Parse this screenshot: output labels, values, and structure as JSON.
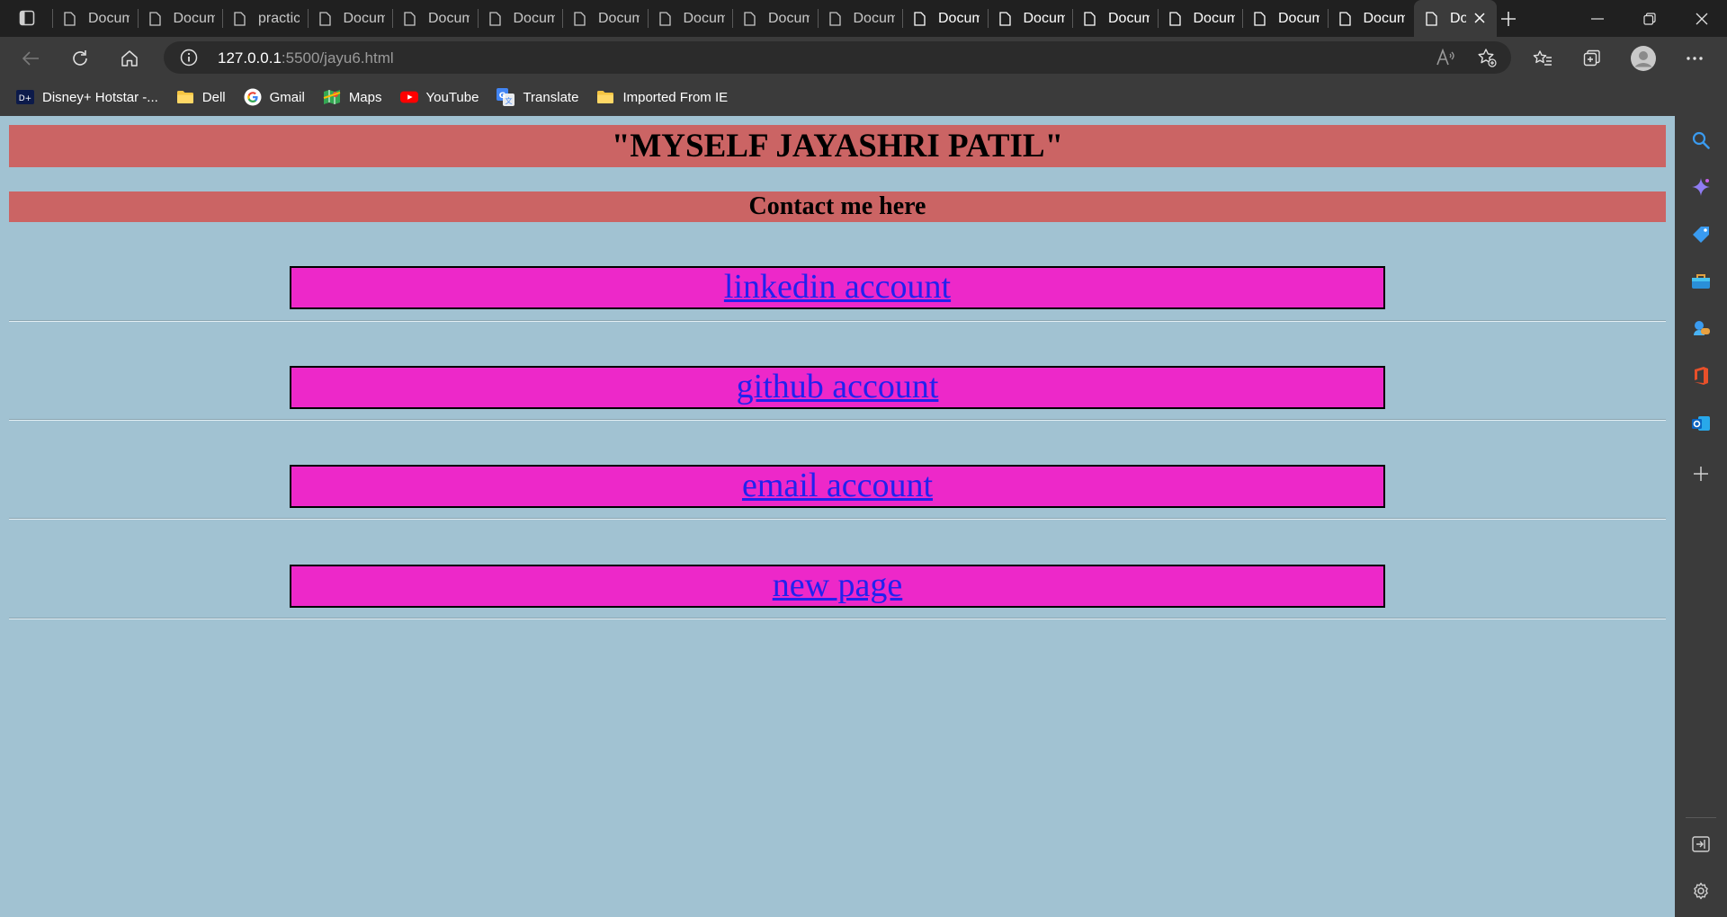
{
  "browser": {
    "tabs": [
      {
        "label": "Docum"
      },
      {
        "label": "Docum"
      },
      {
        "label": "practic"
      },
      {
        "label": "Docum"
      },
      {
        "label": "Docum"
      },
      {
        "label": "Docum"
      },
      {
        "label": "Docum"
      },
      {
        "label": "Docum"
      },
      {
        "label": "Docum"
      },
      {
        "label": "Docum"
      },
      {
        "label": "Docum"
      },
      {
        "label": "Docum"
      },
      {
        "label": "Docum"
      },
      {
        "label": "Docum"
      },
      {
        "label": "Docum"
      },
      {
        "label": "Docum"
      },
      {
        "label": "Do"
      }
    ],
    "active_tab_index": 16,
    "url_host": "127.0.0.1",
    "url_rest": ":5500/jayu6.html",
    "bookmarks": [
      {
        "label": "Disney+ Hotstar -...",
        "icon": "hotstar-icon"
      },
      {
        "label": "Dell",
        "icon": "folder-icon"
      },
      {
        "label": "Gmail",
        "icon": "google-icon"
      },
      {
        "label": "Maps",
        "icon": "maps-icon"
      },
      {
        "label": "YouTube",
        "icon": "youtube-icon"
      },
      {
        "label": "Translate",
        "icon": "translate-icon"
      },
      {
        "label": "Imported From IE",
        "icon": "folder-icon"
      }
    ]
  },
  "page": {
    "title": "\"MYSELF JAYASHRI PATIL\"",
    "contact_heading": "Contact me here",
    "links": [
      {
        "label": "linkedin account"
      },
      {
        "label": "github account"
      },
      {
        "label": "email account"
      },
      {
        "label": "new page"
      }
    ]
  },
  "colors": {
    "page_background": "#a1c2d2",
    "heading_background": "#cb6464",
    "link_box_background": "#ed28c9",
    "link_color": "#2222ee"
  }
}
